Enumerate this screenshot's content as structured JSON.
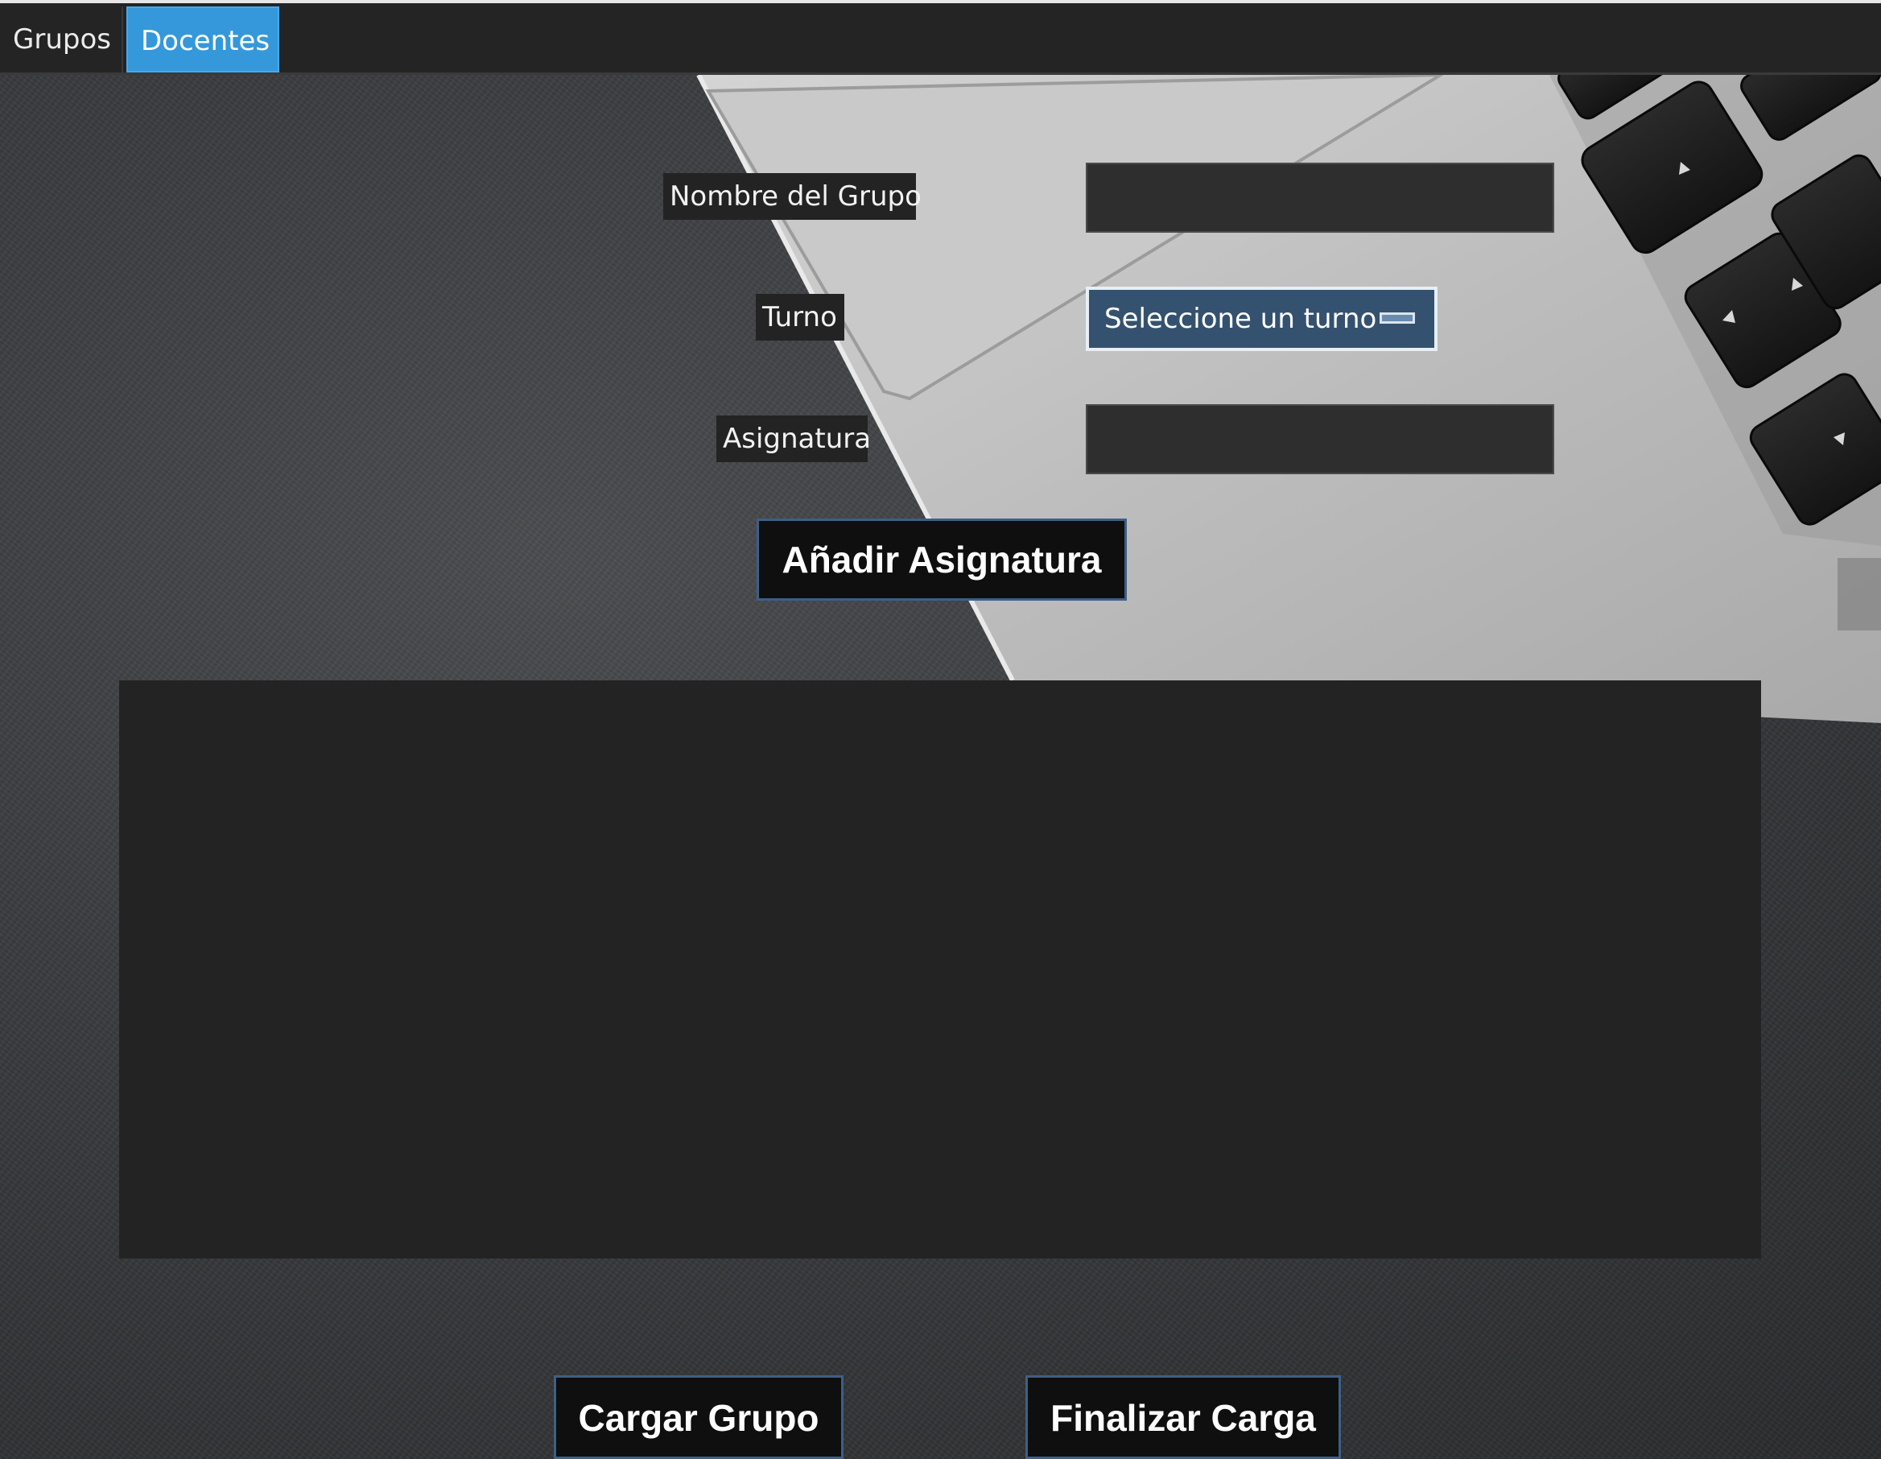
{
  "tabs": [
    {
      "label": "Grupos",
      "active": false
    },
    {
      "label": "Docentes",
      "active": true
    }
  ],
  "form": {
    "nombre_label": "Nombre del Grupo",
    "nombre_value": "",
    "turno_label": "Turno",
    "turno_selected": "Seleccione un turno",
    "asignatura_label": "Asignatura",
    "asignatura_value": ""
  },
  "buttons": {
    "anadir": "Añadir Asignatura",
    "cargar": "Cargar Grupo",
    "finalizar": "Finalizar Carga"
  },
  "colors": {
    "active_tab": "#3498db",
    "button_border": "#3e5f86",
    "select_background": "#34526f"
  }
}
